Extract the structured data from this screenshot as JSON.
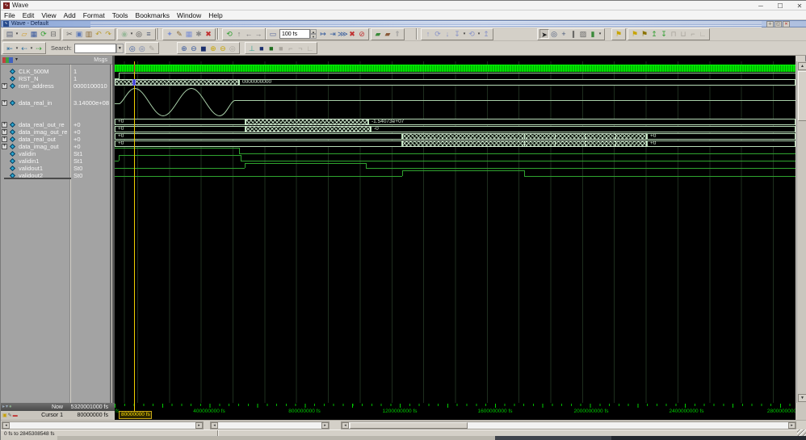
{
  "window": {
    "title": "Wave",
    "minimize": "─",
    "maximize": "☐",
    "close": "✕"
  },
  "menu": {
    "items": [
      "File",
      "Edit",
      "View",
      "Add",
      "Format",
      "Tools",
      "Bookmarks",
      "Window",
      "Help"
    ]
  },
  "subwindow": {
    "title": "Wave - Default"
  },
  "toolbar1": {
    "time_value": "100 fs",
    "gA": [
      {
        "n": "new-document-icon",
        "g": "▤",
        "c": "#55607a",
        "drop": true
      },
      {
        "n": "open-icon",
        "g": "▱",
        "c": "#d09c2e"
      },
      {
        "n": "save-icon",
        "g": "▦",
        "c": "#35569c"
      },
      {
        "n": "reload-icon",
        "g": "⟳",
        "c": "#2f9e2f"
      },
      {
        "n": "print-icon",
        "g": "⊟",
        "c": "#666666"
      }
    ],
    "gB": [
      {
        "n": "cut-icon",
        "g": "✂",
        "c": "#666666"
      },
      {
        "n": "copy-icon",
        "g": "▣",
        "c": "#5a78b8"
      },
      {
        "n": "paste-icon",
        "g": "▥",
        "c": "#8a6a3a"
      },
      {
        "n": "undo-icon",
        "g": "↶",
        "c": "#b89a2e"
      },
      {
        "n": "redo-icon",
        "g": "↷",
        "c": "#b89a2e"
      }
    ],
    "gC": [
      {
        "n": "compile-icon",
        "g": "◉",
        "c": "#9ab89a",
        "drop": true
      },
      {
        "n": "find-icon",
        "g": "◎",
        "c": "#444444"
      },
      {
        "n": "expand-list-icon",
        "g": "≡",
        "c": "#55607a"
      }
    ],
    "gD": [
      {
        "n": "simulate-icon",
        "g": "✦",
        "c": "#7a8fd4"
      },
      {
        "n": "edit-testbench-icon",
        "g": "✎",
        "c": "#8a6a3a"
      },
      {
        "n": "memory-icon",
        "g": "▦",
        "c": "#7a8fd4"
      },
      {
        "n": "options-gear-icon",
        "g": "✱",
        "c": "#888888"
      },
      {
        "n": "end-simulation-icon",
        "g": "✖",
        "c": "#c03030"
      }
    ],
    "gE": [
      {
        "n": "restart-icon",
        "g": "⟲",
        "c": "#2f9e2f"
      },
      {
        "n": "step-up-icon",
        "g": "↑",
        "c": "#777777"
      },
      {
        "n": "step-back-icon",
        "g": "←",
        "c": "#777777"
      },
      {
        "n": "step-forward-icon",
        "g": "→",
        "c": "#777777"
      }
    ],
    "gF": [
      {
        "n": "run-length-icon",
        "g": "▭",
        "c": "#556699"
      }
    ],
    "gG": [
      {
        "n": "run-icon",
        "g": "↦",
        "c": "#335a9c"
      },
      {
        "n": "run-continue-icon",
        "g": "⇥",
        "c": "#335a9c"
      },
      {
        "n": "run-all-icon",
        "g": "⋙",
        "c": "#335a9c"
      },
      {
        "n": "stop-icon",
        "g": "✖",
        "c": "#c03030"
      },
      {
        "n": "break-icon",
        "g": "⊘",
        "c": "#c03030"
      }
    ],
    "gH": [
      {
        "n": "profile-icon",
        "g": "▰",
        "c": "#3a8a3a"
      },
      {
        "n": "coverage-icon",
        "g": "▰",
        "c": "#8a5a3a"
      },
      {
        "n": "upload-icon",
        "g": "⇑",
        "c": "#999999"
      }
    ],
    "gI": [
      {
        "n": "move-up-icon",
        "g": "↑",
        "c": "#8a94c8"
      },
      {
        "n": "reload-wave-icon",
        "g": "⟳",
        "c": "#8a94c8"
      },
      {
        "n": "move-down-icon",
        "g": "↓",
        "c": "#8a94c8"
      },
      {
        "n": "anchor-down-icon",
        "g": "↧",
        "c": "#8a94c8",
        "drop": true
      },
      {
        "n": "re-anchor-icon",
        "g": "⟲",
        "c": "#8a94c8",
        "drop": true
      },
      {
        "n": "anchor-up-icon",
        "g": "↥",
        "c": "#8a94c8"
      }
    ],
    "gJ": [
      {
        "n": "select-mode-icon",
        "g": "➤",
        "c": "#222222",
        "p": true
      },
      {
        "n": "zoom-mode-icon",
        "g": "◎",
        "c": "#445577"
      },
      {
        "n": "pan-mode-icon",
        "g": "+",
        "c": "#445577"
      },
      {
        "n": "cursor-pair-icon",
        "g": "∥",
        "c": "#333333"
      },
      {
        "n": "edit-mode-icon",
        "g": "▨",
        "c": "#666666"
      },
      {
        "n": "stability-check-icon",
        "g": "▮",
        "c": "#3a8a3a",
        "drop": true
      }
    ],
    "gK": [
      {
        "n": "add-flag-icon",
        "g": "⚑",
        "c": "#c8a400"
      }
    ],
    "gL": [
      {
        "n": "flag-next-icon",
        "g": "⚑",
        "c": "#c8a400"
      },
      {
        "n": "flag-prev-icon",
        "g": "⚑",
        "c": "#8a7200"
      },
      {
        "n": "insert-signal-icon",
        "g": "↥",
        "c": "#2f9e2f"
      },
      {
        "n": "append-signal-icon",
        "g": "↧",
        "c": "#2f9e2f"
      },
      {
        "n": "next-rising-edge-icon",
        "g": "⊓",
        "d": true
      },
      {
        "n": "next-falling-edge-icon",
        "g": "⊔",
        "d": true
      },
      {
        "n": "prev-rising-edge-icon",
        "g": "⌐",
        "d": true
      },
      {
        "n": "prev-falling-edge-icon",
        "g": "∟",
        "d": true
      }
    ]
  },
  "toolbar2": {
    "search_label": "Search:",
    "gA": [
      {
        "n": "goto-first-icon",
        "g": "⇤",
        "c": "#2f6f9e",
        "drop": true
      },
      {
        "n": "goto-prev-icon",
        "g": "⇠",
        "c": "#2f6f9e",
        "drop": true
      },
      {
        "n": "goto-active-icon",
        "g": "⇢",
        "c": "#2f9e2f"
      }
    ],
    "gB": [
      {
        "n": "find-next-icon",
        "g": "◎",
        "c": "#35569c"
      },
      {
        "n": "find-prev-icon",
        "g": "◎",
        "c": "#6a7aa8"
      },
      {
        "n": "advanced-find-icon",
        "g": "✎",
        "d": true
      }
    ],
    "gC": [
      {
        "n": "zoom-in-icon",
        "g": "⊕",
        "c": "#35569c"
      },
      {
        "n": "zoom-out-icon",
        "g": "⊖",
        "c": "#35569c"
      },
      {
        "n": "zoom-full-icon",
        "g": "◼",
        "c": "#1a2f6e"
      },
      {
        "n": "zoom-in-active-icon",
        "g": "⊕",
        "c": "#c8a400"
      },
      {
        "n": "zoom-out-active-icon",
        "g": "⊖",
        "c": "#c8a400"
      },
      {
        "n": "zoom-range-icon",
        "g": "◎",
        "d": true
      }
    ],
    "gD": [
      {
        "n": "view-signals-icon",
        "g": "⊥",
        "c": "#2f9e8e"
      },
      {
        "n": "view-compare-icon",
        "g": "■",
        "c": "#1a2f6e"
      },
      {
        "n": "view-memory-icon",
        "g": "■",
        "c": "#1e6e1e"
      },
      {
        "n": "view-list-icon",
        "g": "■",
        "d": true
      },
      {
        "n": "edge-view-1-icon",
        "g": "⌐",
        "d": true
      },
      {
        "n": "edge-view-2-icon",
        "g": "¬",
        "d": true
      },
      {
        "n": "edge-view-3-icon",
        "g": "∟",
        "d": true
      }
    ]
  },
  "signals": {
    "header": "Msgs",
    "rows": [
      {
        "name": "CLK_500M",
        "value": "1"
      },
      {
        "name": "RST_N",
        "value": "1"
      },
      {
        "name": "rom_address",
        "value": "0000100010"
      },
      {
        "name": "data_real_in",
        "value": "3.14000e+08"
      },
      {
        "name": "data_real_out_re",
        "value": "+0"
      },
      {
        "name": "data_imag_out_re",
        "value": "+0"
      },
      {
        "name": "data_real_out",
        "value": "+0"
      },
      {
        "name": "data_imag_out",
        "value": "+0"
      },
      {
        "name": "validin",
        "value": "St1"
      },
      {
        "name": "validin1",
        "value": "St1"
      },
      {
        "name": "validout1",
        "value": "St0"
      },
      {
        "name": "validout2",
        "value": "St0"
      }
    ]
  },
  "wave_labels": {
    "rom_stable": "0000000000",
    "real_out_re_pre": "+0",
    "real_out_re_post": "-1.54073e+07",
    "imag_out_re_pre": "+0",
    "imag_out_re_post": "-0",
    "real_out_pre": "+0",
    "real_out_post": "+0",
    "imag_out_pre": "+0",
    "imag_out_post": "+0"
  },
  "timeline": {
    "ticks": [
      "fs",
      "400000000 fs",
      "800000000 fs",
      "1200000000 fs",
      "1600000000 fs",
      "2000000000 fs",
      "2400000000 fs",
      "2800000000"
    ]
  },
  "cursors": {
    "now_label": "Now",
    "now_value": "5320001000 fs",
    "cursor_label": "Cursor 1",
    "cursor_value": "80000000 fs",
    "cursor_flag": "80000000 fs"
  },
  "status": {
    "range": "0 fs to 2845308548 fs"
  },
  "colors": {
    "accent_green": "#00e400",
    "pale_wave": "#a8cfa8",
    "cursor_yellow": "#f0d000",
    "timeline_green": "#00cc00"
  }
}
